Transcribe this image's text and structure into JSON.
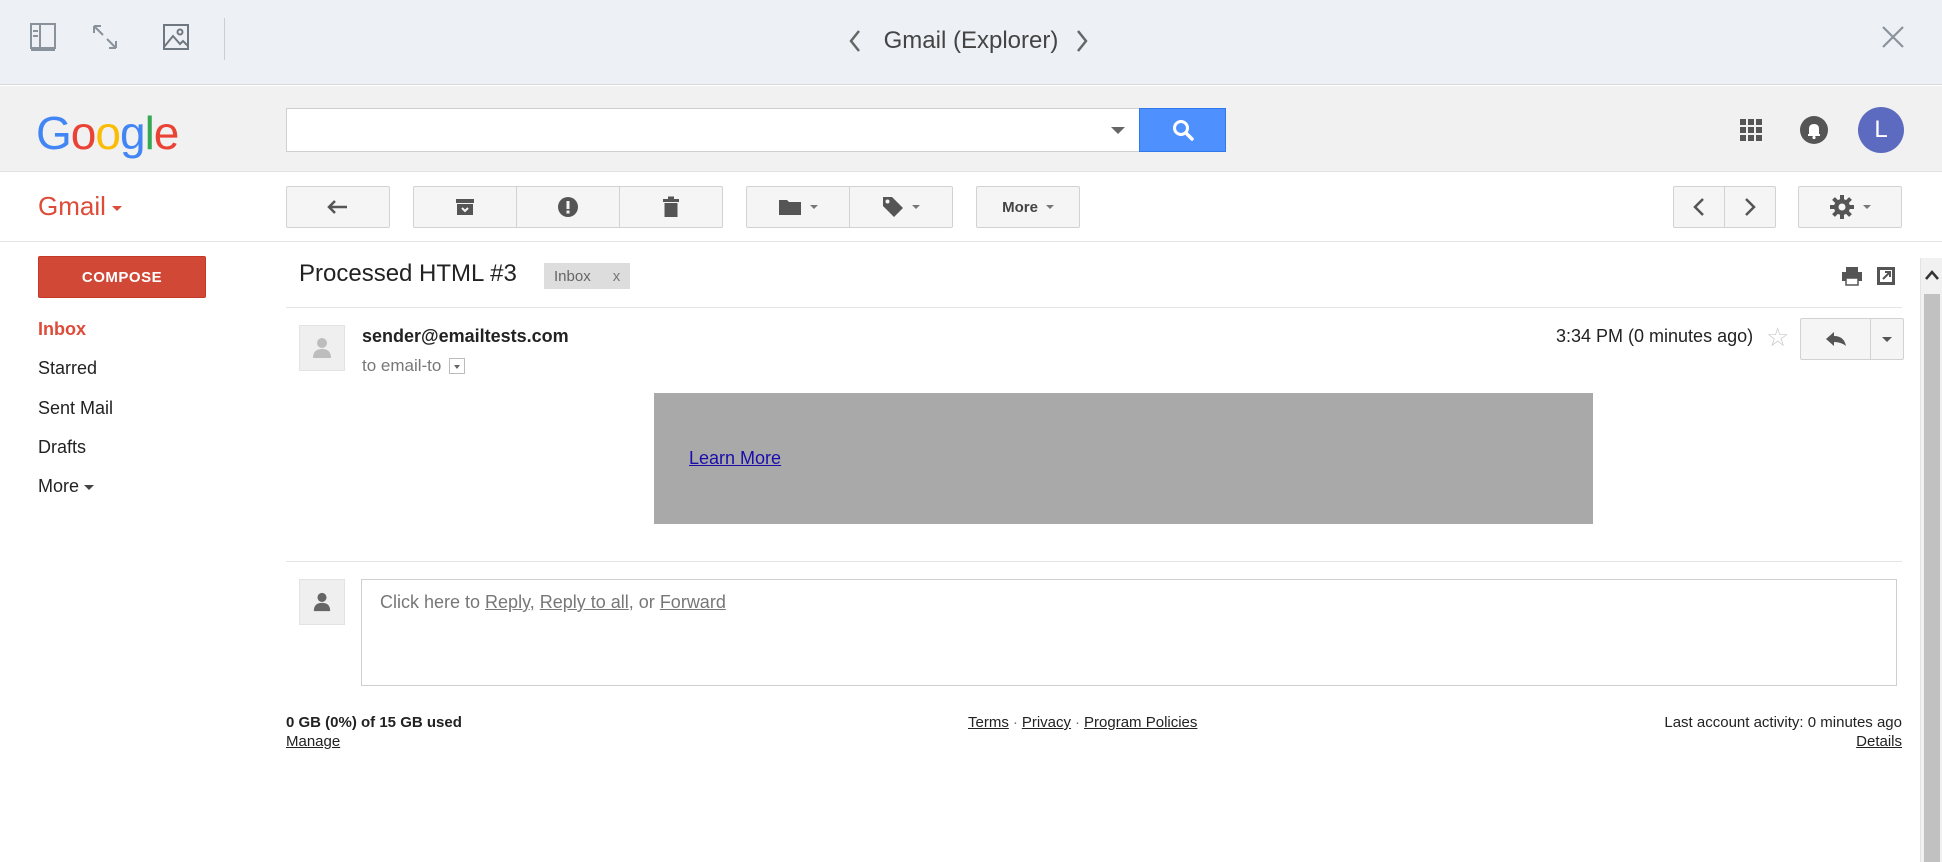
{
  "viewer": {
    "title": "Gmail (Explorer)",
    "icons": [
      "sidebar-icon",
      "expand-icon",
      "image-icon",
      "chevron-left-icon",
      "chevron-right-icon",
      "close-icon"
    ]
  },
  "header": {
    "logo": {
      "l1": "G",
      "l2": "o",
      "l3": "o",
      "l4": "g",
      "l5": "l",
      "l6": "e"
    },
    "search_value": "",
    "avatar_initial": "L",
    "colors": {
      "search_button": "#4d90fe",
      "avatar": "#5c6bc0"
    }
  },
  "toolbar": {
    "app_label": "Gmail",
    "more_label": "More"
  },
  "sidebar": {
    "compose_label": "COMPOSE",
    "items": [
      {
        "label": "Inbox",
        "active": true
      },
      {
        "label": "Starred"
      },
      {
        "label": "Sent Mail"
      },
      {
        "label": "Drafts"
      },
      {
        "label": "More"
      }
    ]
  },
  "email": {
    "subject": "Processed HTML #3",
    "label_chip": "Inbox",
    "label_chip_close": "x",
    "sender": "sender@emailtests.com",
    "to_line": "to email-to",
    "time": "3:34 PM (0 minutes ago)",
    "star": "☆",
    "body_link": "Learn More"
  },
  "reply": {
    "prefix": "Click here to ",
    "reply_link": "Reply",
    "sep1": ", ",
    "reply_all_link": "Reply to all",
    "sep2": ", or ",
    "forward_link": "Forward"
  },
  "footer": {
    "storage": "0 GB (0%) of 15 GB used",
    "manage": "Manage",
    "terms": "Terms",
    "privacy": "Privacy",
    "program_policies": "Program Policies",
    "dot": "·",
    "last_activity": "Last account activity: 0 minutes ago",
    "details": "Details"
  }
}
